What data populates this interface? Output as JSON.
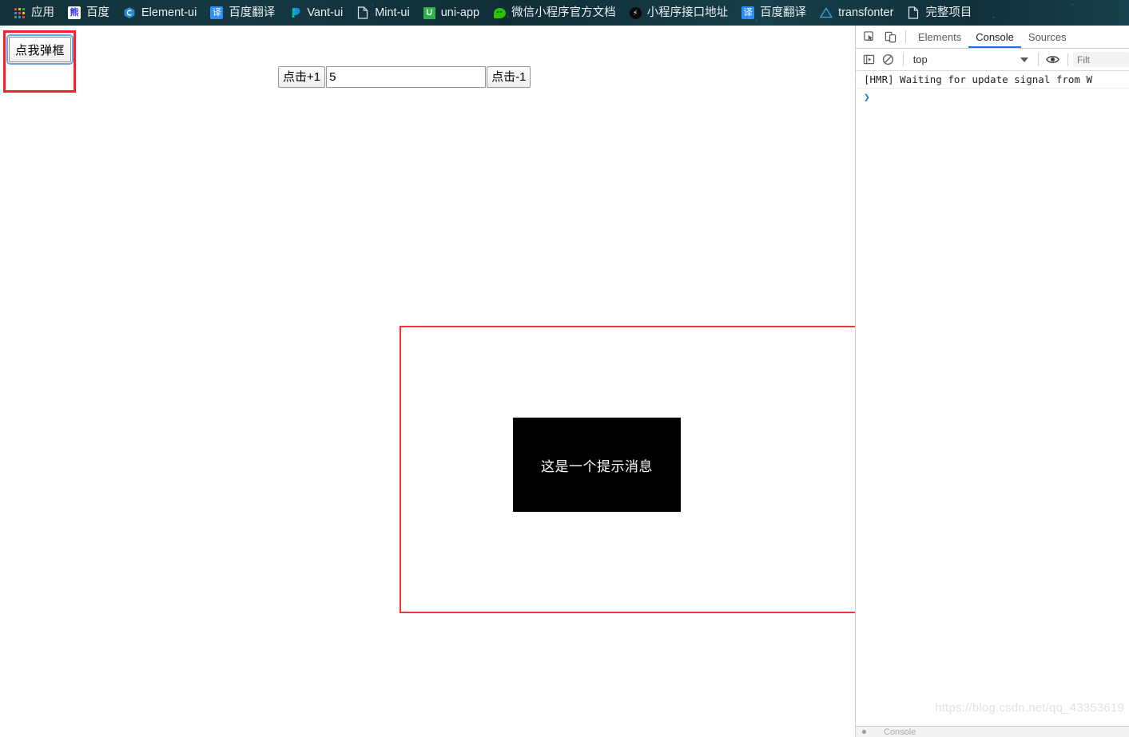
{
  "bookmarks_bar": {
    "items": [
      {
        "label": "应用",
        "icon": "apps-grid-icon"
      },
      {
        "label": "百度",
        "icon": "baidu-icon"
      },
      {
        "label": "Element-ui",
        "icon": "element-ui-icon"
      },
      {
        "label": "百度翻译",
        "icon": "translate-icon"
      },
      {
        "label": "Vant-ui",
        "icon": "vant-ui-icon"
      },
      {
        "label": "Mint-ui",
        "icon": "document-icon"
      },
      {
        "label": "uni-app",
        "icon": "uni-app-icon"
      },
      {
        "label": "微信小程序官方文档",
        "icon": "wechat-icon"
      },
      {
        "label": "小程序接口地址",
        "icon": "miniprogram-icon"
      },
      {
        "label": "百度翻译",
        "icon": "translate-icon"
      },
      {
        "label": "transfonter",
        "icon": "triangle-icon"
      },
      {
        "label": "完整项目",
        "icon": "document-icon"
      }
    ]
  },
  "page": {
    "popup_button_label": "点我弹框",
    "counter": {
      "increment_label": "点击+1",
      "decrement_label": "点击-1",
      "value": "5",
      "placeholder": ""
    },
    "dialog": {
      "toast_message": "这是一个提示消息"
    },
    "highlight_color": "#f5222d",
    "toast_background": "#000000"
  },
  "devtools": {
    "toolbar_icons": [
      {
        "name": "inspect-element-icon"
      },
      {
        "name": "device-toolbar-icon"
      }
    ],
    "tabs": [
      {
        "label": "Elements",
        "active": false
      },
      {
        "label": "Console",
        "active": true
      },
      {
        "label": "Sources",
        "active": false
      }
    ],
    "filter_bar": {
      "execute_icon": "console-sidebar-icon",
      "clear_icon": "clear-console-icon",
      "context": "top",
      "eye_icon": "live-expression-icon",
      "filter_placeholder": "Filt"
    },
    "console": {
      "messages": [
        {
          "text": "[HMR] Waiting for update signal from W"
        }
      ],
      "prompt_symbol": "❯"
    },
    "drawer": {
      "label": "Console"
    },
    "accent_color": "#1a73e8"
  },
  "watermark": {
    "text": "https://blog.csdn.net/qq_43353619"
  }
}
